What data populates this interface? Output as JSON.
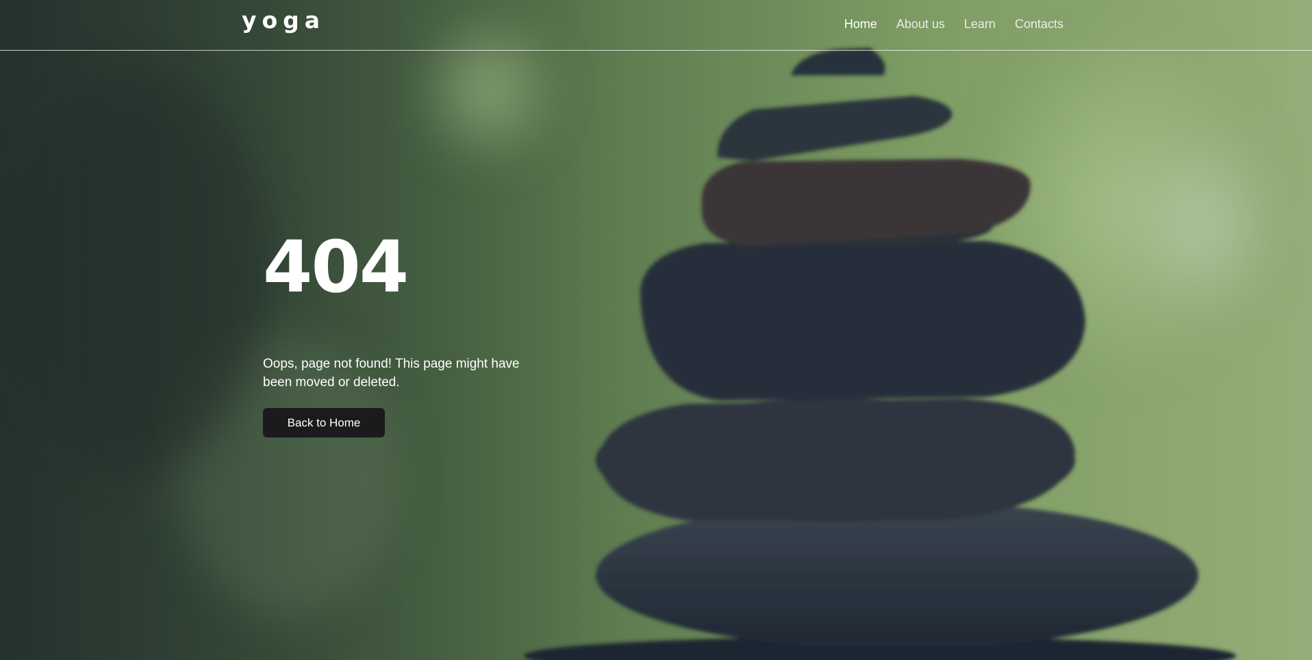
{
  "header": {
    "logo": "yoga",
    "nav": [
      {
        "label": "Home",
        "active": true
      },
      {
        "label": "About us",
        "active": false
      },
      {
        "label": "Learn",
        "active": false
      },
      {
        "label": "Contacts",
        "active": false
      }
    ]
  },
  "main": {
    "error_code": "404",
    "message": "Oops, page not found! This page might have been moved or deleted.",
    "button_label": "Back to Home"
  },
  "colors": {
    "button_bg": "#1b1b1d",
    "text": "#ffffff"
  }
}
